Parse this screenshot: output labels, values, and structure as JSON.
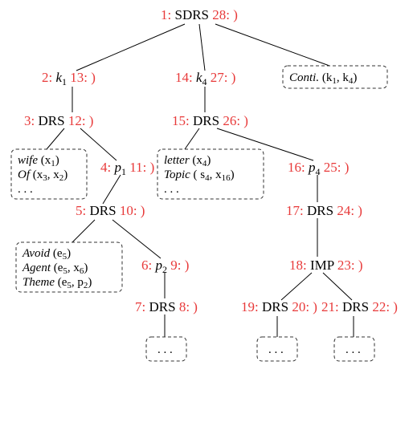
{
  "tree": {
    "root": {
      "open": "1:",
      "label": "SDRS",
      "close": "28: )",
      "children": {
        "k1": {
          "open": "2:",
          "var": "k",
          "sub": "1",
          "close": "13: )",
          "drs": {
            "open": "3:",
            "label": "DRS",
            "close": "12: )",
            "box_lines": [
              {
                "pred": "wife",
                "arg": "(x",
                "sub": "1",
                "tail": ")"
              },
              {
                "pred": "Of",
                "arg": "(x",
                "sub": "3",
                "mid": ", x",
                "sub2": "2",
                "tail": ")"
              },
              {
                "dots": ". . ."
              }
            ],
            "p1": {
              "open": "4:",
              "var": "p",
              "sub": "1",
              "close": "11: )",
              "drs": {
                "open": "5:",
                "label": "DRS",
                "close": "10: )",
                "box_lines": [
                  {
                    "pred": "Avoid",
                    "arg": "(e",
                    "sub": "5",
                    "tail": ")"
                  },
                  {
                    "pred": "Agent",
                    "arg": "(e",
                    "sub": "5",
                    "mid": ", x",
                    "sub2": "6",
                    "tail": ")"
                  },
                  {
                    "pred": "Theme",
                    "arg": "(e",
                    "sub": "5",
                    "mid": ", p",
                    "sub2": "2",
                    "tail": ")"
                  }
                ],
                "p2": {
                  "open": "6:",
                  "var": "p",
                  "sub": "2",
                  "close": "9: )",
                  "drs": {
                    "open": "7:",
                    "label": "DRS",
                    "close": "8: )",
                    "box": ". . ."
                  }
                }
              }
            }
          }
        },
        "k4": {
          "open": "14:",
          "var": "k",
          "sub": "4",
          "close": "27: )",
          "drs": {
            "open": "15:",
            "label": "DRS",
            "close": "26: )",
            "box_lines": [
              {
                "pred": "letter",
                "arg": "(x",
                "sub": "4",
                "tail": ")"
              },
              {
                "pred": "Topic",
                "arg": "( s",
                "sub": "4",
                "mid": ", x",
                "sub2": "16",
                "tail": ")"
              },
              {
                "dots": ". . ."
              }
            ],
            "p4": {
              "open": "16:",
              "var": "p",
              "sub": "4",
              "close": "25: )",
              "drs": {
                "open": "17:",
                "label": "DRS",
                "close": "24: )",
                "imp": {
                  "open": "18:",
                  "label": "IMP",
                  "close": "23: )",
                  "left": {
                    "open": "19:",
                    "label": "DRS",
                    "close": "20: )",
                    "box": ". . ."
                  },
                  "right": {
                    "open": "21:",
                    "label": "DRS",
                    "close": "22: )",
                    "box": ". . ."
                  }
                }
              }
            }
          }
        },
        "conti": {
          "pred": "Conti.",
          "arg_open": "(k",
          "sub1": "1",
          "mid": ", k",
          "sub2": "4",
          "tail": ")"
        }
      }
    }
  }
}
